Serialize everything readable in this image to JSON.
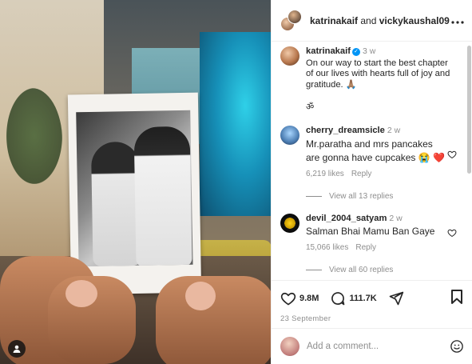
{
  "post": {
    "header": {
      "user1": "katrinakaif",
      "joiner": " and ",
      "user2": "vickykaushal09",
      "more_icon": "more-horizontal-icon"
    },
    "caption": {
      "user": "katrinakaif",
      "verified_icon": "verified-badge-icon",
      "time": "3 w",
      "text": "On our way to start the best chapter of our lives with hearts full of joy and gratitude. 🙏🏽",
      "extra": "ॐ"
    },
    "comments": [
      {
        "user": "cherry_dreamsicle",
        "time": "2 w",
        "text": "Mr.paratha and mrs pancakes are gonna have cupcakes 😭 ❤️",
        "likes": "6,219 likes",
        "reply": "Reply",
        "view_replies": "View all 13 replies"
      },
      {
        "user": "devil_2004_satyam",
        "time": "2 w",
        "text": "Salman Bhai Mamu Ban Gaye",
        "likes": "15,066 likes",
        "reply": "Reply",
        "view_replies": "View all 60 replies"
      }
    ],
    "actions": {
      "likes": "9.8M",
      "comments": "111.7K",
      "date": "23 September"
    },
    "add_comment": {
      "placeholder": "Add a comment..."
    }
  },
  "colors": {
    "accent_blue": "#0095f6",
    "muted_text": "#8e8e8e",
    "text": "#262626"
  }
}
